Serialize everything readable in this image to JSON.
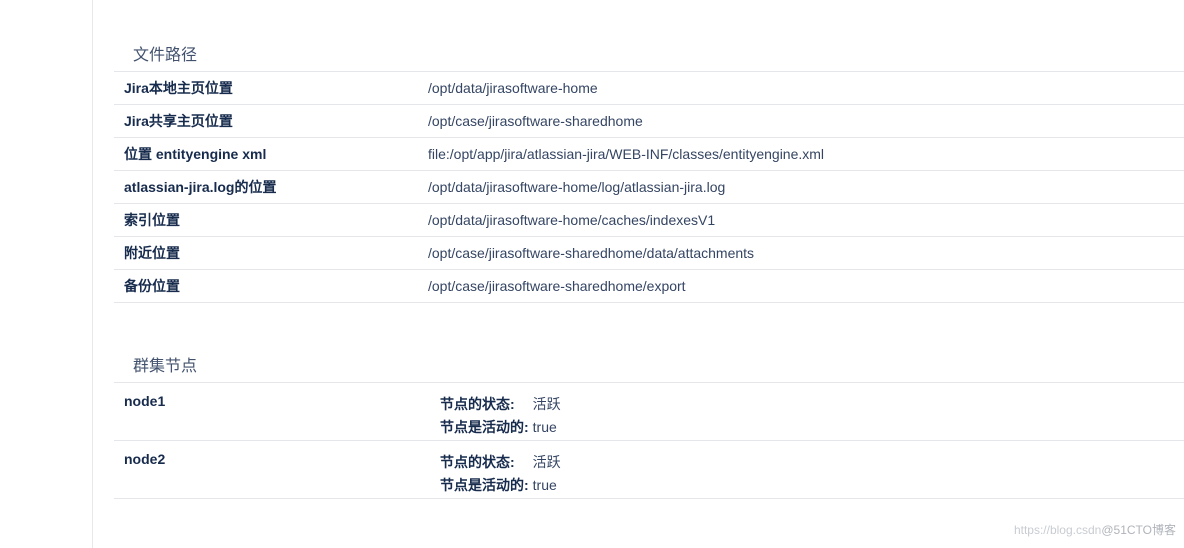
{
  "file_paths": {
    "title": "文件路径",
    "rows": [
      {
        "key": "Jira本地主页位置",
        "value": "/opt/data/jirasoftware-home"
      },
      {
        "key": "Jira共享主页位置",
        "value": "/opt/case/jirasoftware-sharedhome"
      },
      {
        "key": "位置 entityengine xml",
        "value": "file:/opt/app/jira/atlassian-jira/WEB-INF/classes/entityengine.xml"
      },
      {
        "key": "atlassian-jira.log的位置",
        "value": "/opt/data/jirasoftware-home/log/atlassian-jira.log"
      },
      {
        "key": "索引位置",
        "value": "/opt/data/jirasoftware-home/caches/indexesV1"
      },
      {
        "key": "附近位置",
        "value": "/opt/case/jirasoftware-sharedhome/data/attachments"
      },
      {
        "key": "备份位置",
        "value": "/opt/case/jirasoftware-sharedhome/export"
      }
    ]
  },
  "cluster_nodes": {
    "title": "群集节点",
    "state_label": "节点的状态:",
    "active_label": "节点是活动的:",
    "nodes": [
      {
        "name": "node1",
        "state": "活跃",
        "active": "true"
      },
      {
        "name": "node2",
        "state": "活跃",
        "active": "true"
      }
    ]
  },
  "watermark": {
    "url": "https://blog.csdn",
    "brand": "@51CTO博客"
  }
}
